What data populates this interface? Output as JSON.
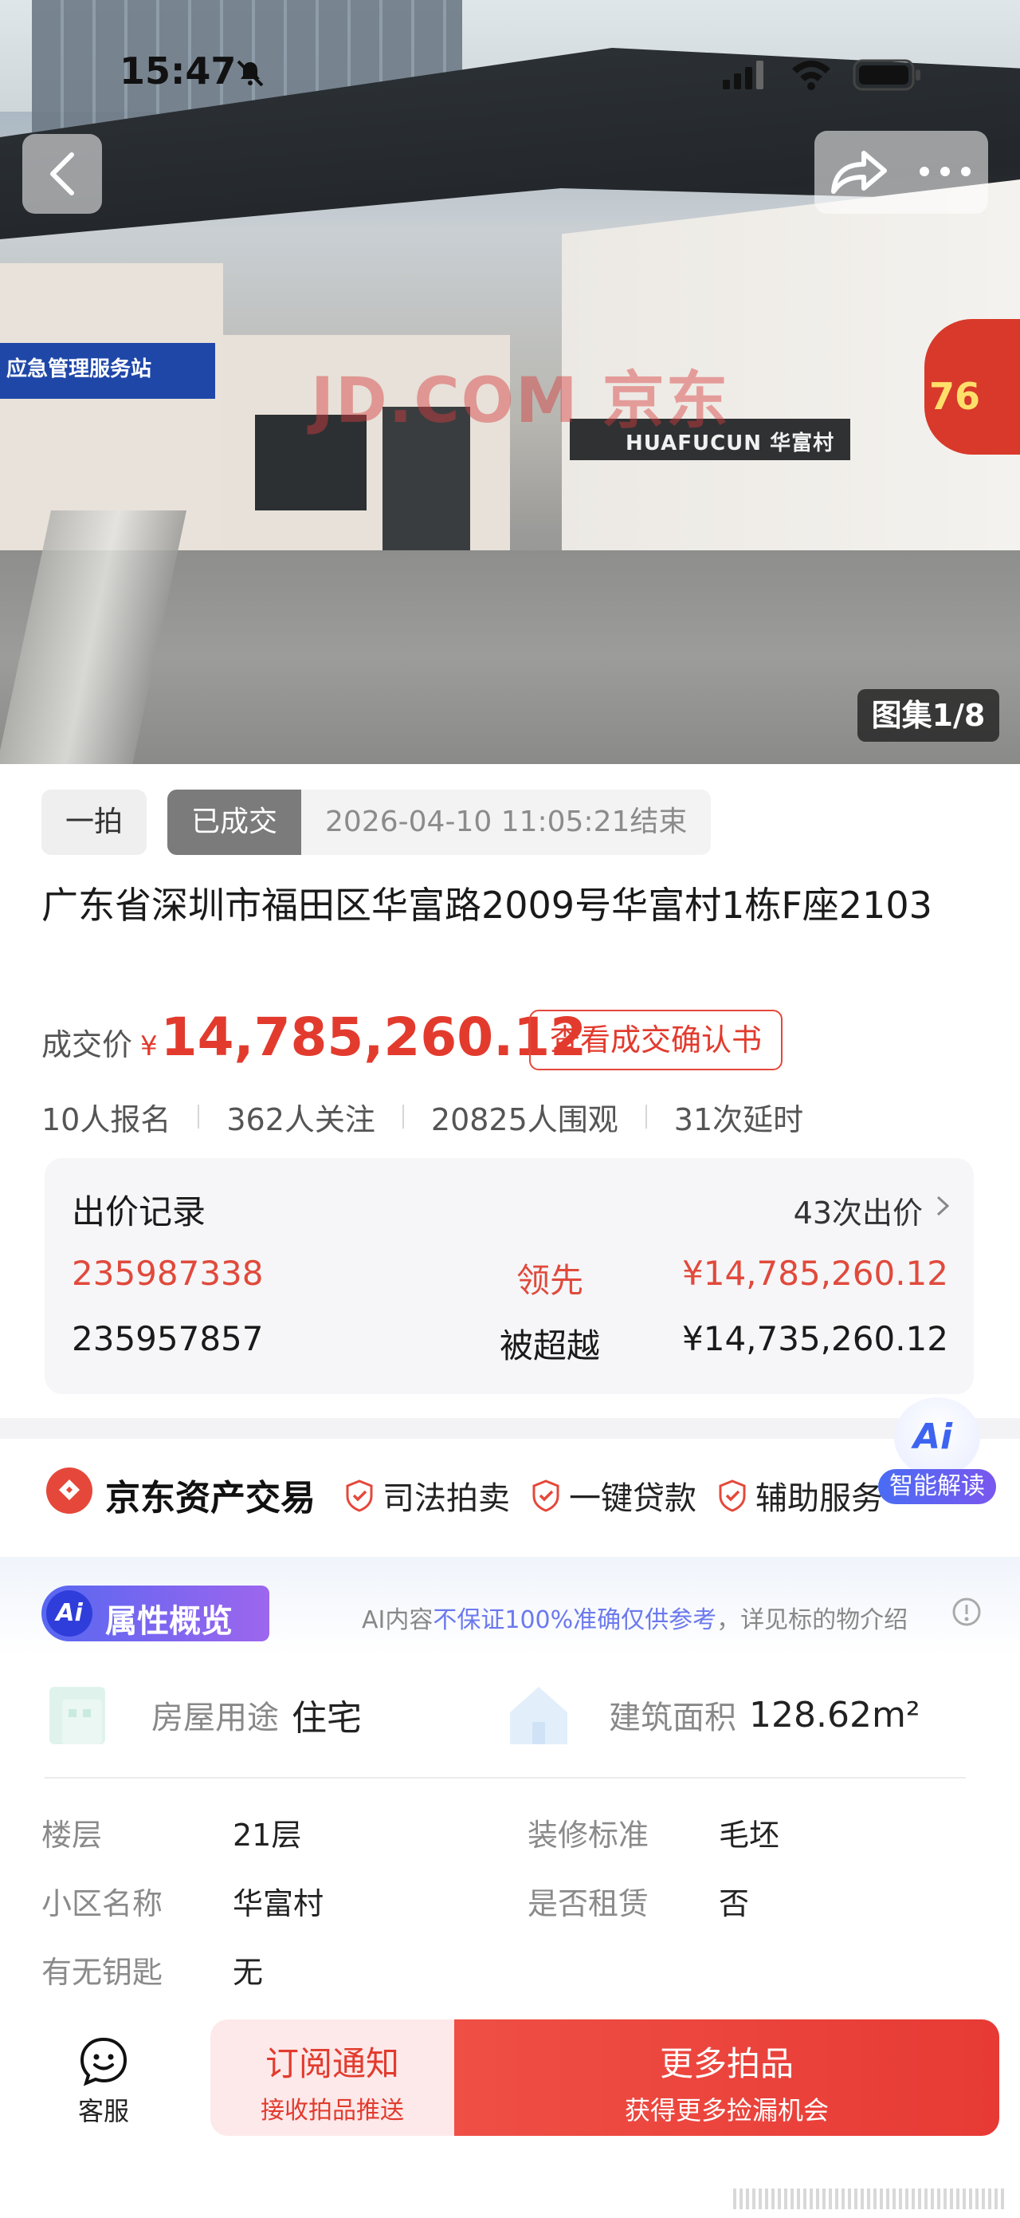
{
  "status_bar": {
    "time": "15:47"
  },
  "hero": {
    "gallery_badge": "图集1/8",
    "sign_text": "HUAFUCUN 华富村",
    "blue_sign_text": "应急管理服务站",
    "badge_number": "76",
    "watermark": "JD.COM 京东"
  },
  "tags": {
    "type": "一拍",
    "status": "已成交",
    "end_time": "2026-04-10 11:05:21结束"
  },
  "title": "广东省深圳市福田区华富路2009号华富村1栋F座2103",
  "price": {
    "label": "成交价",
    "currency": "¥",
    "value": "14,785,260.12",
    "confirm_button": "查看成交确认书"
  },
  "stats": [
    "10人报名",
    "362人关注",
    "20825人围观",
    "31次延时"
  ],
  "bids": {
    "title": "出价记录",
    "count": "43次出价",
    "rows": [
      {
        "id": "235987338",
        "status": "领先",
        "amount": "¥14,785,260.12"
      },
      {
        "id": "235957857",
        "status": "被超越",
        "amount": "¥14,735,260.12"
      }
    ]
  },
  "services": {
    "brand": "京东资产交易",
    "items": [
      "司法拍卖",
      "一键贷款",
      "辅助服务"
    ]
  },
  "ai_float": {
    "label": "智能解读",
    "icon_text": "Ai"
  },
  "attributes": {
    "badge": "属性概览",
    "badge_icon": "Ai",
    "disclaimer_prefix": "AI内容",
    "disclaimer_highlight": "不保证100%准确仅供参考",
    "disclaimer_suffix": "，详见标的物介绍",
    "feature_usage_key": "房屋用途",
    "feature_usage_value": "住宅",
    "feature_area_key": "建筑面积",
    "feature_area_value": "128.62m²",
    "floor_key": "楼层",
    "floor_value": "21层",
    "decor_key": "装修标准",
    "decor_value": "毛坯",
    "community_key": "小区名称",
    "community_value": "华富村",
    "rent_key": "是否租赁",
    "rent_value": "否",
    "key_key": "有无钥匙",
    "key_value": "无"
  },
  "bottom_bar": {
    "cs_label": "客服",
    "subscribe_title": "订阅通知",
    "subscribe_sub": "接收拍品推送",
    "more_title": "更多拍品",
    "more_sub": "获得更多捡漏机会"
  },
  "colors": {
    "accent_red": "#e23b2e",
    "ai_blue": "#4a6cf4",
    "muted_gray": "#8a8a8a"
  }
}
